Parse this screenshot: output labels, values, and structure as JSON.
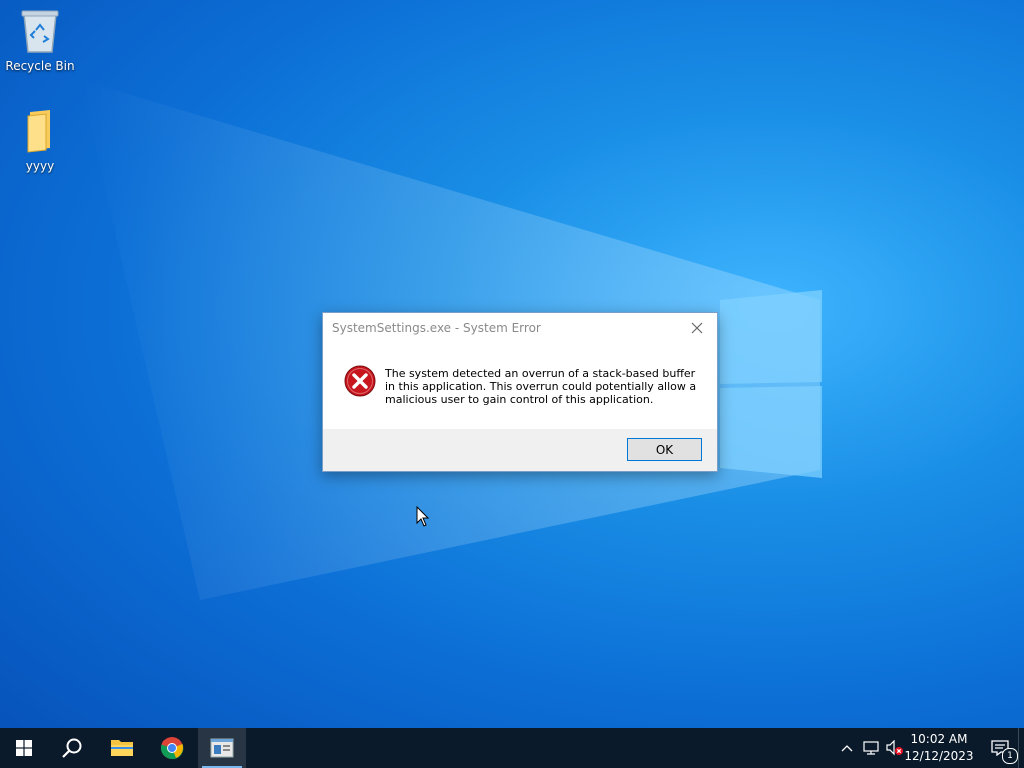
{
  "desktop": {
    "icons": [
      {
        "label": "Recycle Bin",
        "icon": "recycle-bin-icon"
      },
      {
        "label": "yyyy",
        "icon": "folder-icon"
      }
    ]
  },
  "dialog": {
    "title": "SystemSettings.exe - System Error",
    "message": "The system detected an overrun of a stack-based buffer in this application. This overrun could potentially allow a malicious user to gain control of this application.",
    "ok_label": "OK",
    "icon": "error-icon",
    "close_icon": "close-icon"
  },
  "taskbar": {
    "items": [
      {
        "icon": "windows-start-icon"
      },
      {
        "icon": "search-icon"
      },
      {
        "icon": "file-explorer-icon"
      },
      {
        "icon": "chrome-icon"
      },
      {
        "icon": "system-settings-app-icon",
        "active": true
      }
    ],
    "tray": {
      "icons": [
        "chevron-up-icon",
        "network-icon",
        "volume-muted-icon"
      ],
      "time": "10:02 AM",
      "date": "12/12/2023",
      "notification_count": "1"
    }
  },
  "colors": {
    "accent": "#0078d7",
    "taskbar": "#0a1a2b",
    "error_red": "#c8161d"
  }
}
